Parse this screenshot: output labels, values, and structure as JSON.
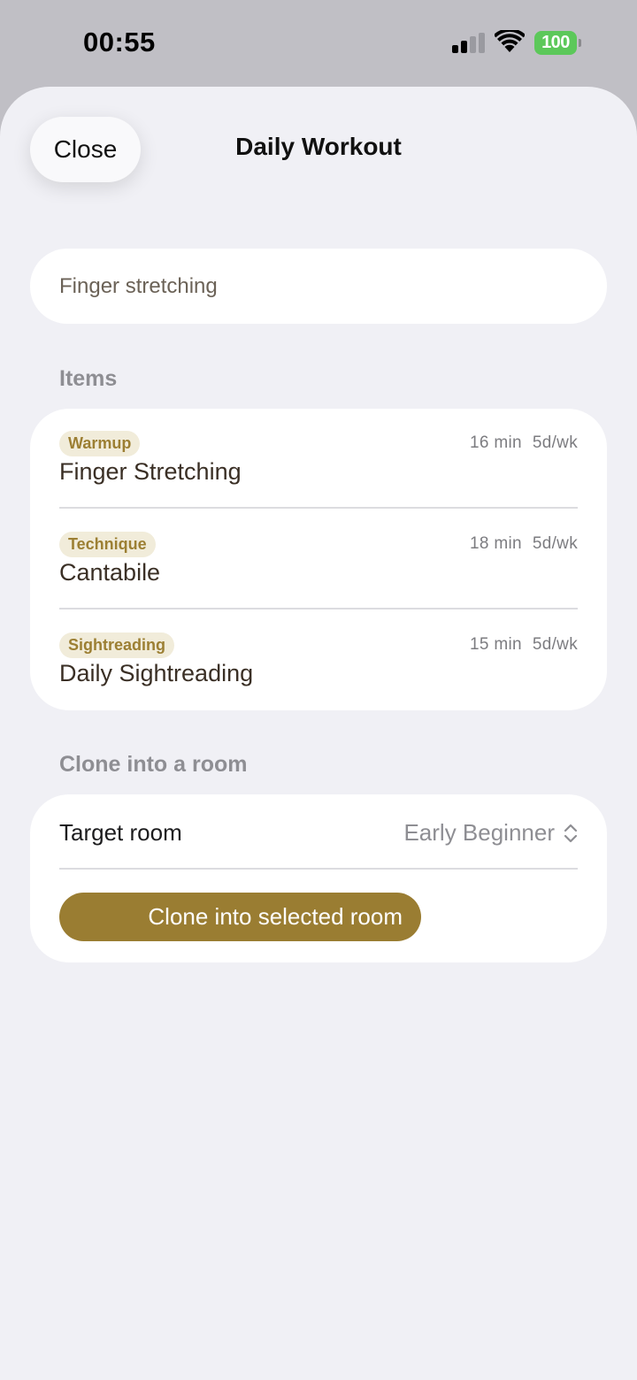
{
  "status_bar": {
    "time": "00:55",
    "battery": "100",
    "battery_color": "#5cc85a"
  },
  "nav": {
    "close_label": "Close",
    "title": "Daily Workout"
  },
  "name_field": {
    "value": "Finger stretching"
  },
  "items_section": {
    "header": "Items",
    "items": [
      {
        "tag": "Warmup",
        "title": "Finger Stretching",
        "duration": "16 min",
        "frequency": "5d/wk"
      },
      {
        "tag": "Technique",
        "title": "Cantabile",
        "duration": "18 min",
        "frequency": "5d/wk"
      },
      {
        "tag": "Sightreading",
        "title": "Daily Sightreading",
        "duration": "15 min",
        "frequency": "5d/wk"
      }
    ]
  },
  "clone_section": {
    "header": "Clone into a room",
    "target_room_label": "Target room",
    "selected_room": "Early Beginner",
    "clone_button_label": "Clone into selected room",
    "accent_color": "#9a7d32"
  }
}
